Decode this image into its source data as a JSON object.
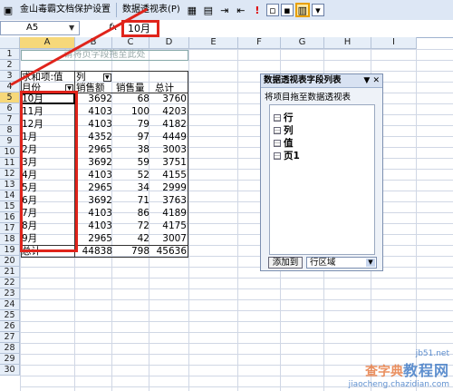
{
  "toolbar": {
    "doc_protect_label": "金山毒霸文档保护设置",
    "pivot_menu_label": "数据透视表(P)"
  },
  "formula_bar": {
    "name_box": "A5",
    "fx": "fx",
    "value": "10月"
  },
  "columns": [
    "A",
    "B",
    "C",
    "D",
    "E",
    "F",
    "G",
    "H",
    "I"
  ],
  "rows": [
    "1",
    "2",
    "3",
    "4",
    "5",
    "6",
    "7",
    "8",
    "9",
    "10",
    "11",
    "12",
    "13",
    "14",
    "15",
    "16",
    "17",
    "18",
    "19",
    "20",
    "21",
    "22",
    "23",
    "24",
    "25",
    "26",
    "27",
    "28",
    "29",
    "30"
  ],
  "pivot": {
    "page_hint": "请将页字段拖至此处",
    "data_label": "求和项:值",
    "column_field": "列",
    "row_field": "月份",
    "headers": [
      "销售额",
      "销售量",
      "总计"
    ],
    "table": [
      [
        "10月",
        "3692",
        "68",
        "3760"
      ],
      [
        "11月",
        "4103",
        "100",
        "4203"
      ],
      [
        "12月",
        "4103",
        "79",
        "4182"
      ],
      [
        "1月",
        "4352",
        "97",
        "4449"
      ],
      [
        "2月",
        "2965",
        "38",
        "3003"
      ],
      [
        "3月",
        "3692",
        "59",
        "3751"
      ],
      [
        "4月",
        "4103",
        "52",
        "4155"
      ],
      [
        "5月",
        "2965",
        "34",
        "2999"
      ],
      [
        "6月",
        "3692",
        "71",
        "3763"
      ],
      [
        "7月",
        "4103",
        "86",
        "4189"
      ],
      [
        "8月",
        "4103",
        "72",
        "4175"
      ],
      [
        "9月",
        "2965",
        "42",
        "3007"
      ]
    ],
    "total_row": [
      "总计",
      "44838",
      "798",
      "45636"
    ]
  },
  "field_list": {
    "title": "数据透视表字段列表",
    "subtitle": "将项目拖至数据透视表",
    "fields": [
      "行",
      "列",
      "值",
      "页1"
    ],
    "add_button": "添加到",
    "area_select": "行区域"
  },
  "watermark": {
    "line1": "查字典",
    "line2": "教程网",
    "line3": "jiaocheng.chazidian.com",
    "site": "jb51.net"
  },
  "colors": {
    "highlight_red": "#e0241b",
    "header_selected": "#f6d87a"
  }
}
